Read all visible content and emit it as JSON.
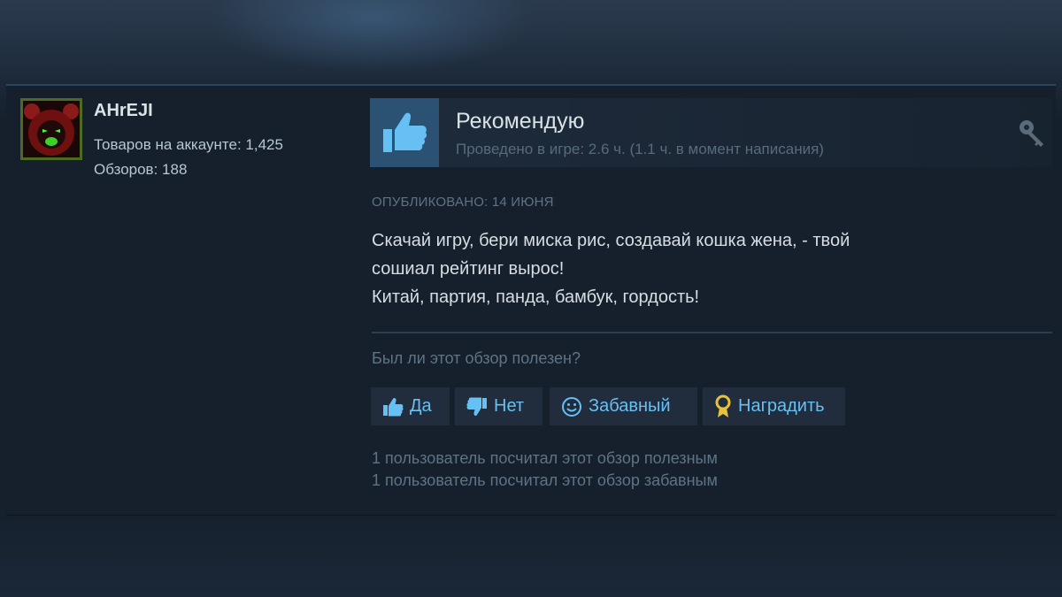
{
  "reviewer": {
    "name": "AHrEJI",
    "products": "Товаров на аккаунте: 1,425",
    "reviews": "Обзоров: 188"
  },
  "review": {
    "verdict": "Рекомендую",
    "hours": "Проведено в игре: 2.6 ч. (1.1 ч. в момент написания)",
    "posted": "Опубликовано: 14 июня",
    "text_lines": [
      "Скачай игру, бери миска рис, создавай кошка жена, - твой",
      "сошиал рейтинг вырос!",
      "Китай, партия, панда, бамбук, гордость!"
    ]
  },
  "feedback": {
    "question": "Был ли этот обзор полезен?",
    "yes_label": "Да",
    "no_label": "Нет",
    "funny_label": "Забавный",
    "award_label": "Наградить",
    "helpful_count": "1 пользователь посчитал этот обзор полезным",
    "funny_count": "1 пользователь посчитал этот обзор забавным"
  },
  "icons": {
    "thumb": "thumbs-up-icon",
    "key": "key-icon",
    "yes": "thumbs-up-icon",
    "no": "thumbs-down-icon",
    "funny": "smiley-icon",
    "award": "award-icon"
  },
  "colors": {
    "accent": "#66c0f4",
    "thumb_bg": "#2b5173",
    "avatar_border": "#4c6b22"
  }
}
